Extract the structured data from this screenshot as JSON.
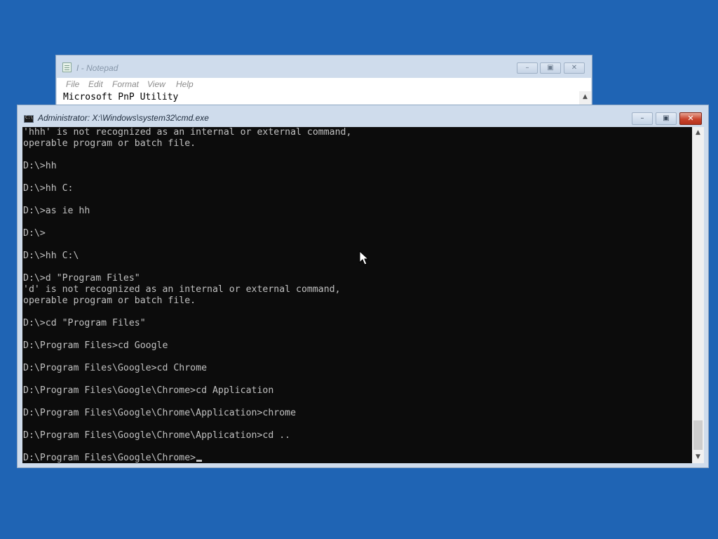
{
  "notepad": {
    "title": "I - Notepad",
    "menu": [
      "File",
      "Edit",
      "Format",
      "View",
      "Help"
    ],
    "content": "Microsoft PnP Utility",
    "icon": "notepad-icon"
  },
  "cmd": {
    "title": "Administrator: X:\\Windows\\system32\\cmd.exe",
    "icon": "cmd-icon",
    "lines": [
      "'hhh' is not recognized as an internal or external command,",
      "operable program or batch file.",
      "",
      "D:\\>hh",
      "",
      "D:\\>hh C:",
      "",
      "D:\\>as ie hh",
      "",
      "D:\\>",
      "",
      "D:\\>hh C:\\",
      "",
      "D:\\>d \"Program Files\"",
      "'d' is not recognized as an internal or external command,",
      "operable program or batch file.",
      "",
      "D:\\>cd \"Program Files\"",
      "",
      "D:\\Program Files>cd Google",
      "",
      "D:\\Program Files\\Google>cd Chrome",
      "",
      "D:\\Program Files\\Google\\Chrome>cd Application",
      "",
      "D:\\Program Files\\Google\\Chrome\\Application>chrome",
      "",
      "D:\\Program Files\\Google\\Chrome\\Application>cd ..",
      "",
      "D:\\Program Files\\Google\\Chrome>"
    ]
  },
  "colors": {
    "desktop": "#1f64b4",
    "console_bg": "#0c0c0c",
    "console_fg": "#c0c0c0",
    "close_button": "#c8442c"
  }
}
